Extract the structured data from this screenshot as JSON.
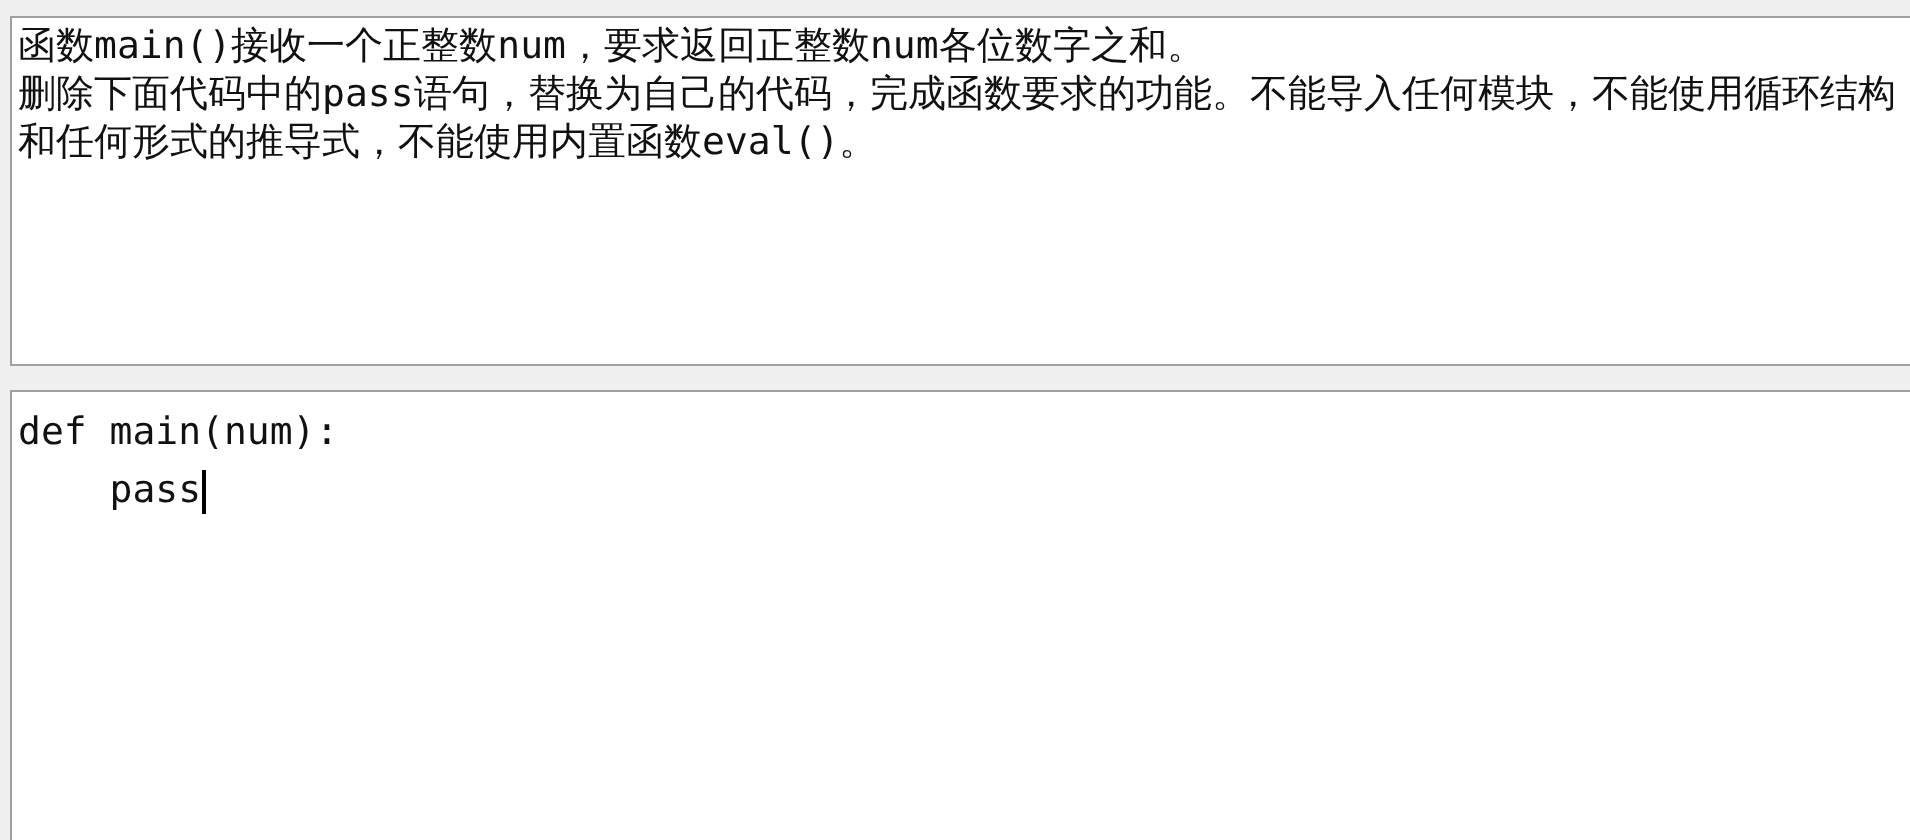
{
  "problem": {
    "paragraphs": [
      "函数main()接收一个正整数num，要求返回正整数num各位数字之和。",
      "删除下面代码中的pass语句，替换为自己的代码，完成函数要求的功能。不能导入任何模块，不能使用循环结构和任何形式的推导式，不能使用内置函数eval()。"
    ]
  },
  "editor": {
    "lines": [
      {
        "text": "def main(num):",
        "cursor": false
      },
      {
        "text": "    pass",
        "cursor": true
      }
    ]
  }
}
